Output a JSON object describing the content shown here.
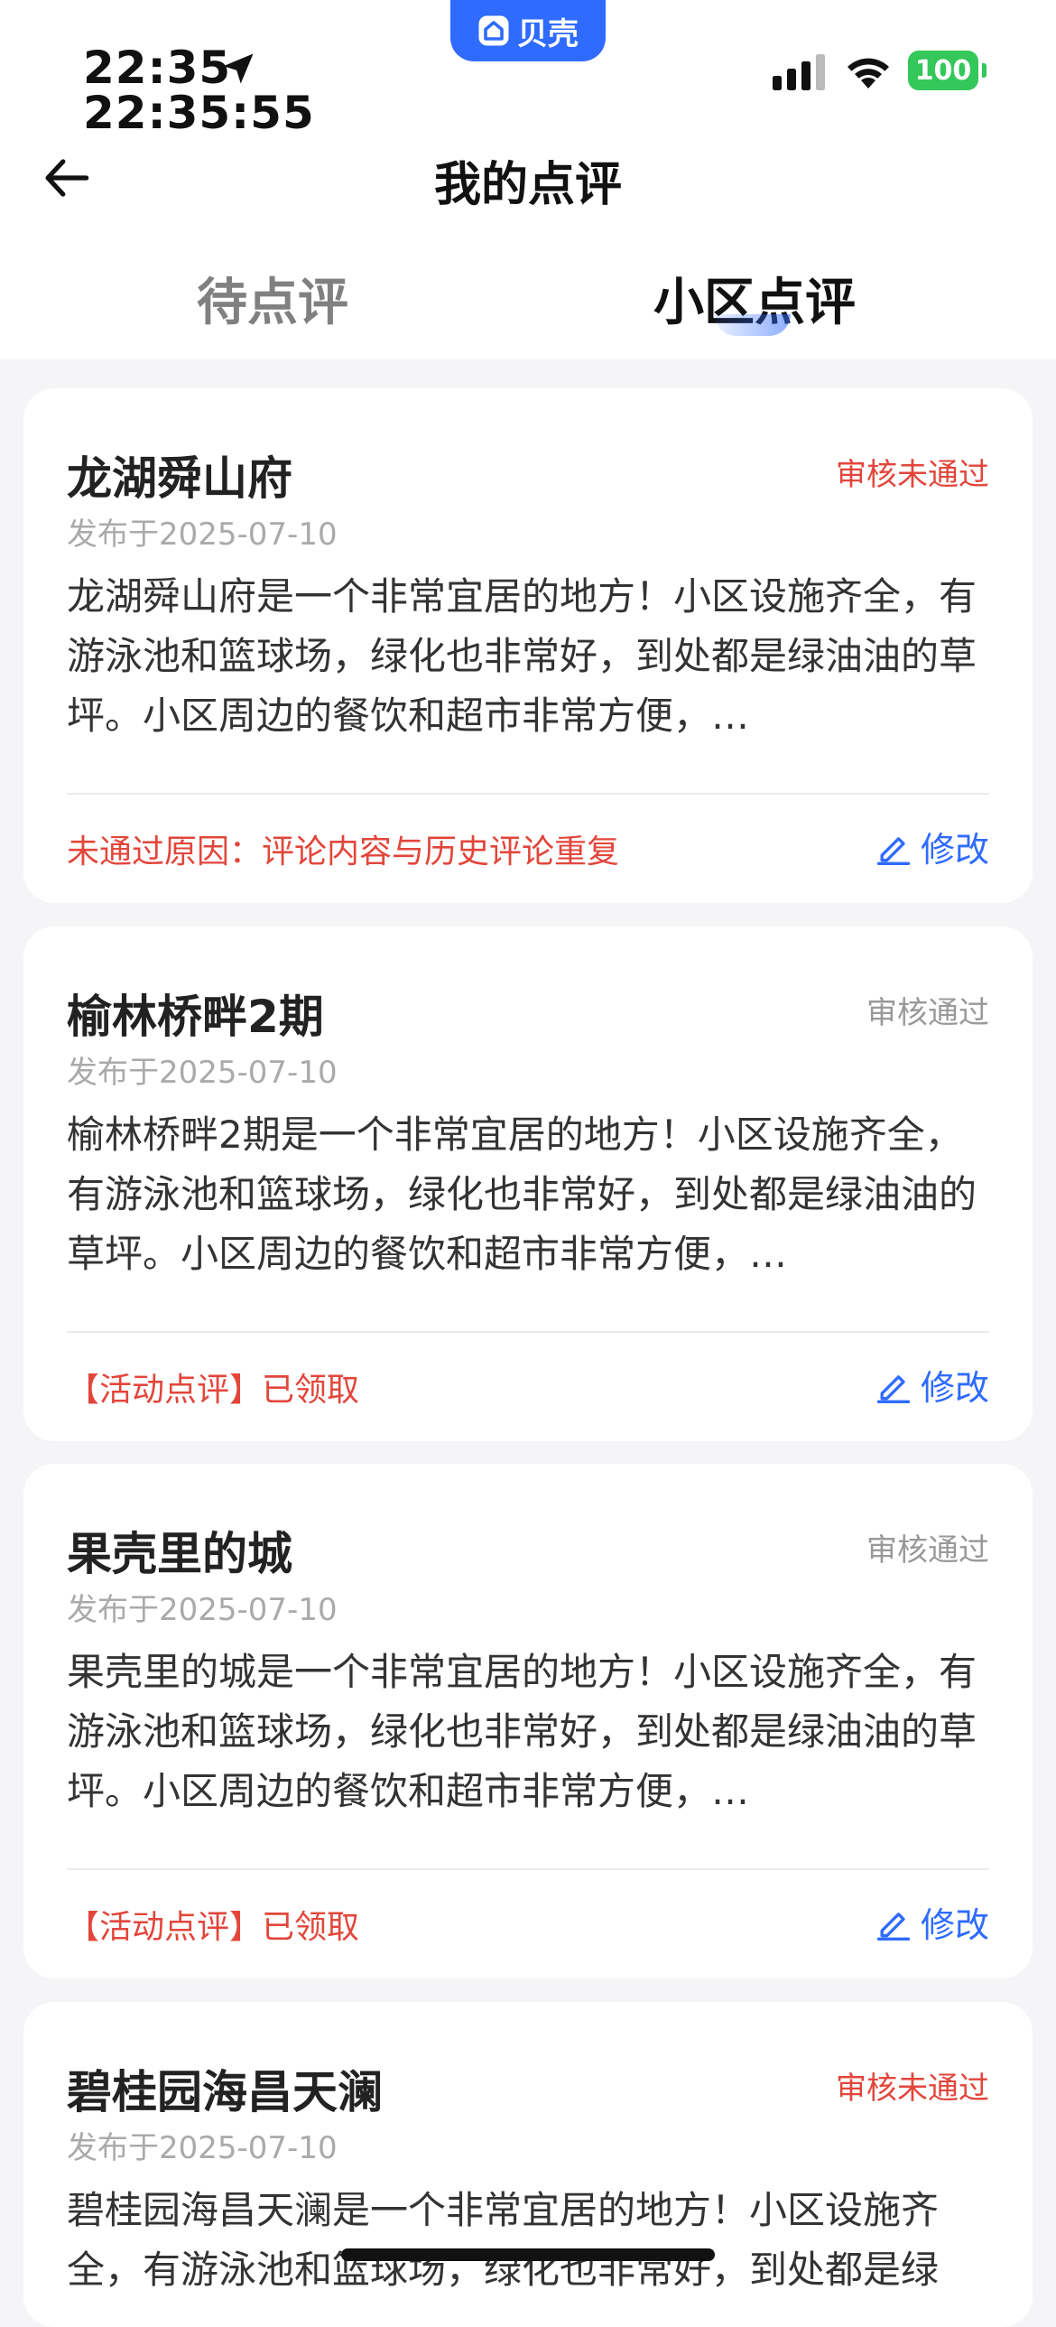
{
  "status_bar": {
    "time": "22:35",
    "time_seconds": "22:35:55",
    "app_badge": "贝壳",
    "battery": "100"
  },
  "nav": {
    "title": "我的点评"
  },
  "tabs": [
    {
      "label": "待点评",
      "active": false
    },
    {
      "label": "小区点评",
      "active": true
    }
  ],
  "reviews": [
    {
      "name": "龙湖舜山府",
      "status": "审核未通过",
      "date": "发布于2025-07-10",
      "content": "龙湖舜山府是一个非常宜居的地方！小区设施齐全，有游泳池和篮球场，绿化也非常好，到处都是绿油油的草坪。小区周边的餐饮和超市非常方便，…",
      "note": "未通过原因：评论内容与历史评论重复",
      "edit_label": "修改"
    },
    {
      "name": "榆林桥畔2期",
      "status": "审核通过",
      "date": "发布于2025-07-10",
      "content": "榆林桥畔2期是一个非常宜居的地方！小区设施齐全，有游泳池和篮球场，绿化也非常好，到处都是绿油油的草坪。小区周边的餐饮和超市非常方便，…",
      "note": "【活动点评】已领取",
      "edit_label": "修改"
    },
    {
      "name": "果壳里的城",
      "status": "审核通过",
      "date": "发布于2025-07-10",
      "content": "果壳里的城是一个非常宜居的地方！小区设施齐全，有游泳池和篮球场，绿化也非常好，到处都是绿油油的草坪。小区周边的餐饮和超市非常方便，…",
      "note": "【活动点评】已领取",
      "edit_label": "修改"
    },
    {
      "name": "碧桂园海昌天澜",
      "status": "审核未通过",
      "date": "发布于2025-07-10",
      "content": "碧桂园海昌天澜是一个非常宜居的地方！小区设施齐全，有游泳池和篮球场，绿化也非常好，到处都是绿"
    }
  ]
}
